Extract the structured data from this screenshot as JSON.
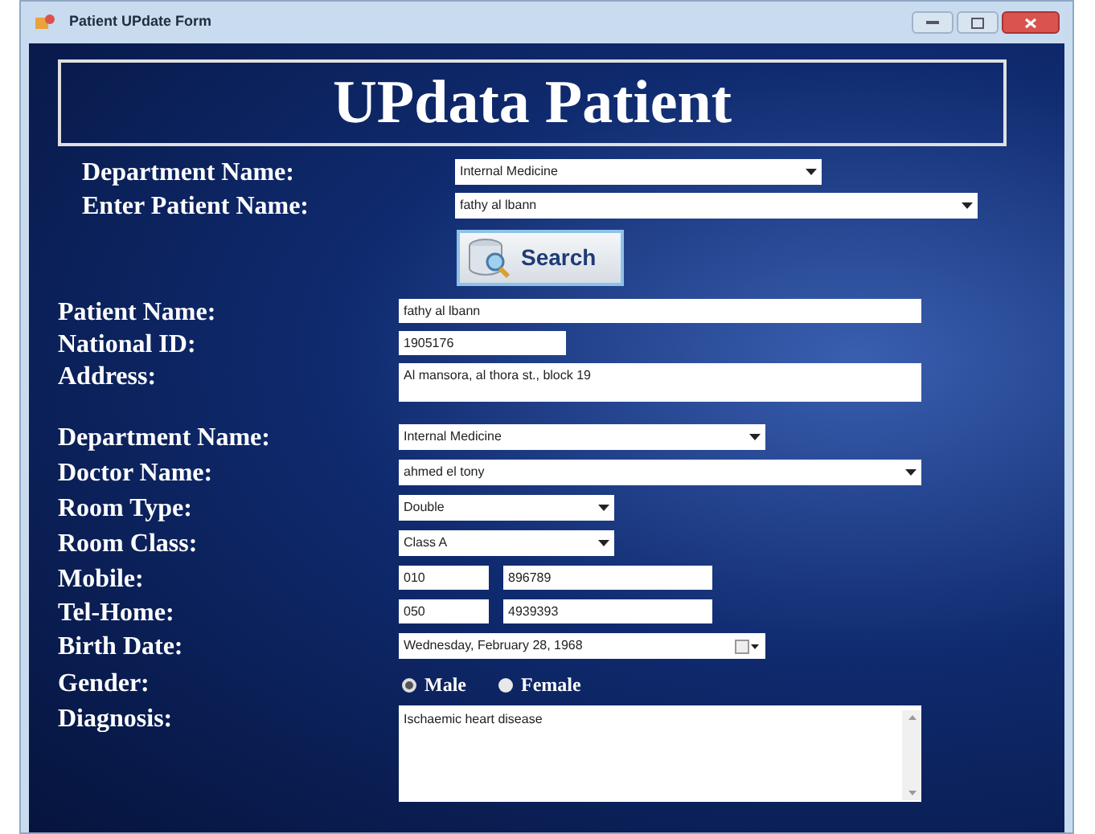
{
  "window": {
    "title": "Patient UPdate Form"
  },
  "heading": "UPdata Patient",
  "search_section": {
    "rows": [
      {
        "label": "Department Name:",
        "kind": "select",
        "value": "Internal Medicine"
      },
      {
        "label": "Enter Patient Name:",
        "kind": "select",
        "value": "fathy al lbann"
      }
    ],
    "button": "Search"
  },
  "form": [
    {
      "label": "Patient Name:",
      "kind": "text",
      "value": "fathy al lbann"
    },
    {
      "label": "National ID:",
      "kind": "text",
      "value": "1905176"
    },
    {
      "label": "Address:",
      "kind": "multiline",
      "value": "Al mansora, al thora st., block 19"
    },
    {
      "label": "Department Name:",
      "kind": "select",
      "value": "Internal Medicine"
    },
    {
      "label": "Doctor Name:",
      "kind": "select",
      "value": "ahmed el tony"
    },
    {
      "label": "Room Type:",
      "kind": "select",
      "value": "Double"
    },
    {
      "label": "Room Class:",
      "kind": "select",
      "value": "Class A"
    },
    {
      "label": "Mobile:",
      "kind": "phone",
      "prefix": "010",
      "value": "896789"
    },
    {
      "label": "Tel-Home:",
      "kind": "phone",
      "prefix": "050",
      "value": "4939393"
    },
    {
      "label": "Birth Date:",
      "kind": "date",
      "value": "Wednesday,  February  28, 1968"
    },
    {
      "label": "Gender:",
      "kind": "radio",
      "options": [
        {
          "label": "Male",
          "selected": true
        },
        {
          "label": "Female",
          "selected": false
        }
      ]
    },
    {
      "label": "Diagnosis:",
      "kind": "textarea",
      "value": "Ischaemic heart disease"
    }
  ]
}
